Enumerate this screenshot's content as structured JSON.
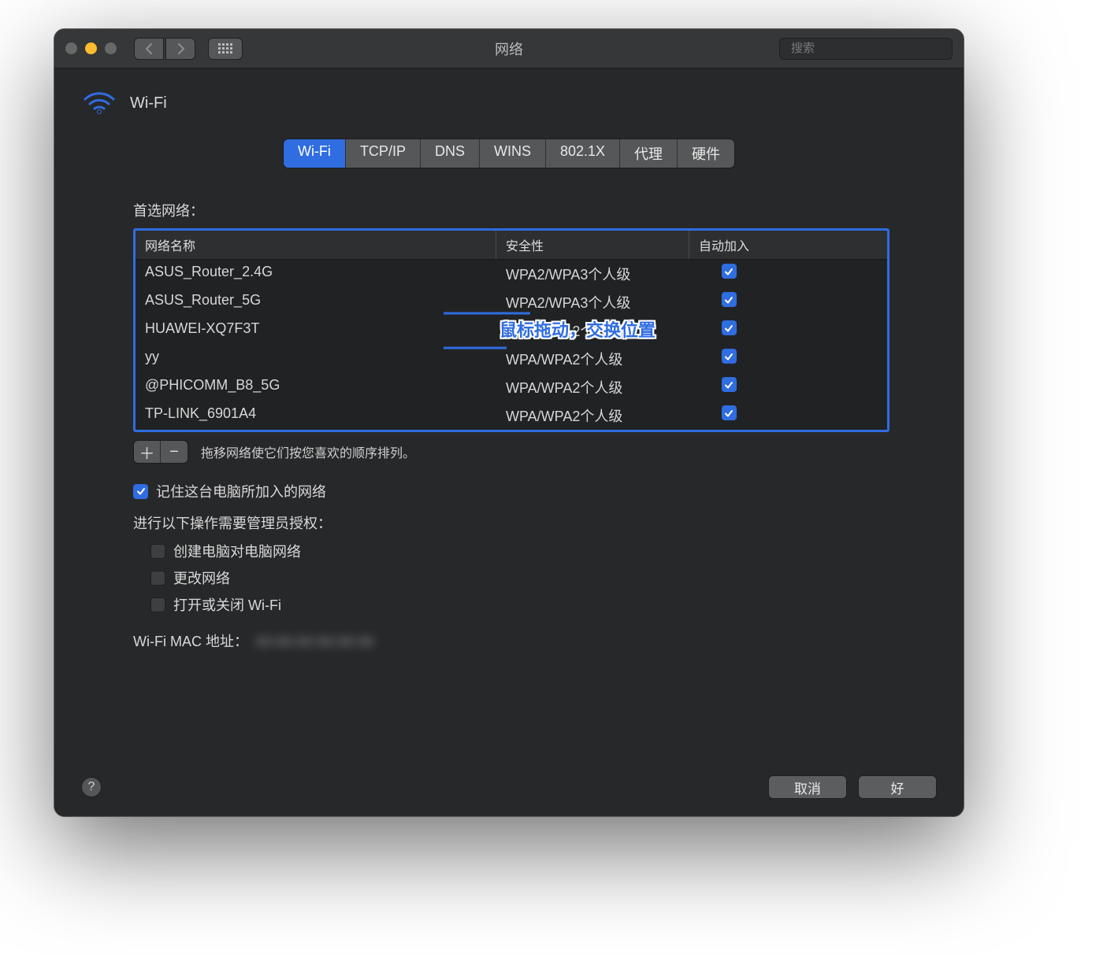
{
  "window": {
    "title": "网络"
  },
  "search": {
    "placeholder": "搜索"
  },
  "header": {
    "wifi_label": "Wi-Fi"
  },
  "tabs": [
    "Wi-Fi",
    "TCP/IP",
    "DNS",
    "WINS",
    "802.1X",
    "代理",
    "硬件"
  ],
  "tabs_selected_index": 0,
  "preferred_networks": {
    "label": "首选网络：",
    "columns": {
      "name": "网络名称",
      "security": "安全性",
      "auto": "自动加入"
    },
    "rows": [
      {
        "name": "ASUS_Router_2.4G",
        "security": "WPA2/WPA3个人级",
        "auto": true
      },
      {
        "name": "ASUS_Router_5G",
        "security": "WPA2/WPA3个人级",
        "auto": true
      },
      {
        "name": "HUAWEI-XQ7F3T",
        "security": "WPA/WPA2个人级",
        "auto": true
      },
      {
        "name": "yy",
        "security": "WPA/WPA2个人级",
        "auto": true
      },
      {
        "name": "@PHICOMM_B8_5G",
        "security": "WPA/WPA2个人级",
        "auto": true
      },
      {
        "name": "TP-LINK_6901A4",
        "security": "WPA/WPA2个人级",
        "auto": true
      }
    ],
    "hint": "拖移网络使它们按您喜欢的顺序排列。"
  },
  "remember": {
    "label": "记住这台电脑所加入的网络",
    "checked": true
  },
  "admin": {
    "label": "进行以下操作需要管理员授权：",
    "options": [
      {
        "label": "创建电脑对电脑网络",
        "checked": false
      },
      {
        "label": "更改网络",
        "checked": false
      },
      {
        "label": "打开或关闭 Wi-Fi",
        "checked": false
      }
    ]
  },
  "mac": {
    "label": "Wi-Fi MAC 地址：",
    "value": "xx:xx:xx:xx:xx:xx"
  },
  "buttons": {
    "cancel": "取消",
    "ok": "好"
  },
  "annotation": {
    "text": "鼠标拖动，交换位置"
  },
  "colors": {
    "accent": "#2f6de0",
    "window_bg": "#27282a",
    "titlebar_bg": "#363739"
  }
}
